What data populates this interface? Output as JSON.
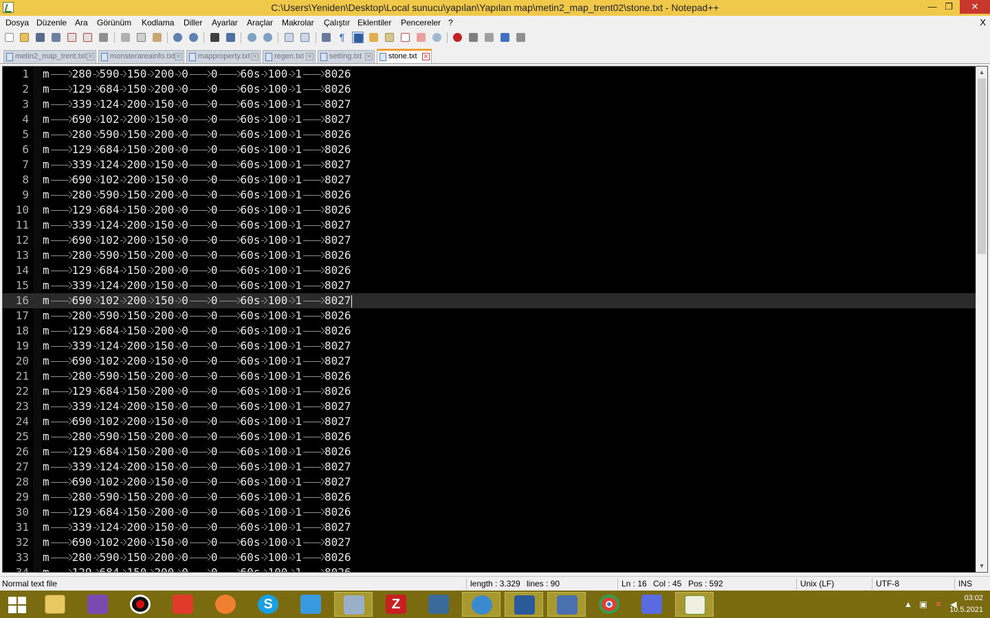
{
  "window": {
    "title": "C:\\Users\\Yeniden\\Desktop\\Local sunucu\\yapılan\\Yapılan map\\metin2_map_trent02\\stone.txt - Notepad++"
  },
  "menu": {
    "items": [
      "Dosya",
      "Düzenle",
      "Ara",
      "Görünüm",
      "Kodlama",
      "Diller",
      "Ayarlar",
      "Araçlar",
      "Makrolar",
      "Çalıştır",
      "Eklentiler",
      "Pencereler",
      "?"
    ],
    "close": "X"
  },
  "tabs": [
    {
      "label": "metin2_map_trent.txt",
      "active": false
    },
    {
      "label": "monsterareainfo.txt",
      "active": false
    },
    {
      "label": "mapproperty.txt",
      "active": false
    },
    {
      "label": "regen.txt",
      "active": false
    },
    {
      "label": "setting.txt",
      "active": false
    },
    {
      "label": "stone.txt",
      "active": true
    }
  ],
  "editor": {
    "current_line": 16,
    "line_patterns": [
      [
        "m",
        "280",
        "590",
        "150",
        "200",
        "0",
        "0",
        "60s",
        "100",
        "1",
        "8026"
      ],
      [
        "m",
        "129",
        "684",
        "150",
        "200",
        "0",
        "0",
        "60s",
        "100",
        "1",
        "8026"
      ],
      [
        "m",
        "339",
        "124",
        "200",
        "150",
        "0",
        "0",
        "60s",
        "100",
        "1",
        "8027"
      ],
      [
        "m",
        "690",
        "102",
        "200",
        "150",
        "0",
        "0",
        "60s",
        "100",
        "1",
        "8027"
      ]
    ],
    "visible_line_count": 34
  },
  "status": {
    "file_type": "Normal text file",
    "length": "length : 3.329",
    "lines": "lines : 90",
    "ln": "Ln : 16",
    "col": "Col : 45",
    "pos": "Pos : 592",
    "eol": "Unix (LF)",
    "encoding": "UTF-8",
    "mode": "INS"
  },
  "taskbar": {
    "apps": [
      "windows-start",
      "file-explorer",
      "visual-studio",
      "obs-studio",
      "anydesk",
      "avast",
      "skype",
      "zoom",
      "paint-tool",
      "filezilla",
      "remote-tool",
      "firefox-dev",
      "virtualbox",
      "network-tool",
      "chrome",
      "discord",
      "notepad-plus-plus"
    ],
    "active_app": "notepad-plus-plus",
    "time": "03:02",
    "date": "10.5.2021"
  },
  "colors": {
    "titlebar": "#f0c94a",
    "editor_bg": "#000000",
    "editor_fg": "#e8e8e8",
    "current_line_bg": "#2b2b2b",
    "taskbar": "#7a6a10",
    "active_tab_accent": "#f0a030"
  }
}
